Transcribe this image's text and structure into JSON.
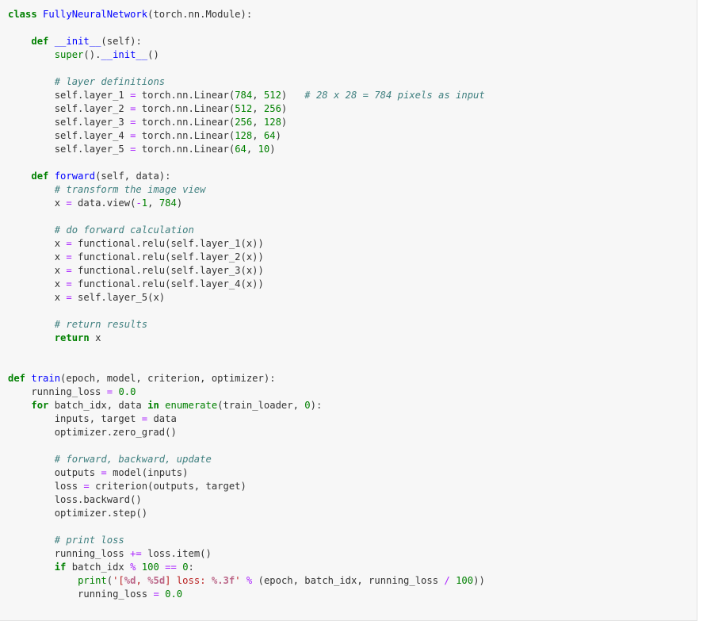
{
  "editor": {
    "language": "python",
    "lines": [
      [
        {
          "t": "class",
          "c": "kw"
        },
        {
          "t": " "
        },
        {
          "t": "FullyNeuralNetwork",
          "c": "fn"
        },
        {
          "t": "(torch.nn.Module):"
        }
      ],
      [],
      [
        {
          "t": "    "
        },
        {
          "t": "def",
          "c": "kw"
        },
        {
          "t": " "
        },
        {
          "t": "__init__",
          "c": "fn"
        },
        {
          "t": "(self):"
        }
      ],
      [
        {
          "t": "        "
        },
        {
          "t": "super",
          "c": "bi"
        },
        {
          "t": "()."
        },
        {
          "t": "__init__",
          "c": "fn"
        },
        {
          "t": "()"
        }
      ],
      [],
      [
        {
          "t": "        "
        },
        {
          "t": "# layer definitions",
          "c": "cm"
        }
      ],
      [
        {
          "t": "        self.layer_1 "
        },
        {
          "t": "=",
          "c": "op"
        },
        {
          "t": " torch.nn.Linear("
        },
        {
          "t": "784",
          "c": "num"
        },
        {
          "t": ", "
        },
        {
          "t": "512",
          "c": "num"
        },
        {
          "t": ")   "
        },
        {
          "t": "# 28 x 28 = 784 pixels as input",
          "c": "cm"
        }
      ],
      [
        {
          "t": "        self.layer_2 "
        },
        {
          "t": "=",
          "c": "op"
        },
        {
          "t": " torch.nn.Linear("
        },
        {
          "t": "512",
          "c": "num"
        },
        {
          "t": ", "
        },
        {
          "t": "256",
          "c": "num"
        },
        {
          "t": ")"
        }
      ],
      [
        {
          "t": "        self.layer_3 "
        },
        {
          "t": "=",
          "c": "op"
        },
        {
          "t": " torch.nn.Linear("
        },
        {
          "t": "256",
          "c": "num"
        },
        {
          "t": ", "
        },
        {
          "t": "128",
          "c": "num"
        },
        {
          "t": ")"
        }
      ],
      [
        {
          "t": "        self.layer_4 "
        },
        {
          "t": "=",
          "c": "op"
        },
        {
          "t": " torch.nn.Linear("
        },
        {
          "t": "128",
          "c": "num"
        },
        {
          "t": ", "
        },
        {
          "t": "64",
          "c": "num"
        },
        {
          "t": ")"
        }
      ],
      [
        {
          "t": "        self.layer_5 "
        },
        {
          "t": "=",
          "c": "op"
        },
        {
          "t": " torch.nn.Linear("
        },
        {
          "t": "64",
          "c": "num"
        },
        {
          "t": ", "
        },
        {
          "t": "10",
          "c": "num"
        },
        {
          "t": ")"
        }
      ],
      [],
      [
        {
          "t": "    "
        },
        {
          "t": "def",
          "c": "kw"
        },
        {
          "t": " "
        },
        {
          "t": "forward",
          "c": "fn"
        },
        {
          "t": "(self, data):"
        }
      ],
      [
        {
          "t": "        "
        },
        {
          "t": "# transform the image view",
          "c": "cm"
        }
      ],
      [
        {
          "t": "        x "
        },
        {
          "t": "=",
          "c": "op"
        },
        {
          "t": " data.view("
        },
        {
          "t": "-",
          "c": "op"
        },
        {
          "t": "1",
          "c": "num"
        },
        {
          "t": ", "
        },
        {
          "t": "784",
          "c": "num"
        },
        {
          "t": ")"
        }
      ],
      [],
      [
        {
          "t": "        "
        },
        {
          "t": "# do forward calculation",
          "c": "cm"
        }
      ],
      [
        {
          "t": "        x "
        },
        {
          "t": "=",
          "c": "op"
        },
        {
          "t": " functional.relu(self.layer_1(x))"
        }
      ],
      [
        {
          "t": "        x "
        },
        {
          "t": "=",
          "c": "op"
        },
        {
          "t": " functional.relu(self.layer_2(x))"
        }
      ],
      [
        {
          "t": "        x "
        },
        {
          "t": "=",
          "c": "op"
        },
        {
          "t": " functional.relu(self.layer_3(x))"
        }
      ],
      [
        {
          "t": "        x "
        },
        {
          "t": "=",
          "c": "op"
        },
        {
          "t": " functional.relu(self.layer_4(x))"
        }
      ],
      [
        {
          "t": "        x "
        },
        {
          "t": "=",
          "c": "op"
        },
        {
          "t": " self.layer_5(x)"
        }
      ],
      [],
      [
        {
          "t": "        "
        },
        {
          "t": "# return results",
          "c": "cm"
        }
      ],
      [
        {
          "t": "        "
        },
        {
          "t": "return",
          "c": "kw"
        },
        {
          "t": " x"
        }
      ],
      [],
      [],
      [
        {
          "t": "def",
          "c": "kw"
        },
        {
          "t": " "
        },
        {
          "t": "train",
          "c": "fn"
        },
        {
          "t": "(epoch, model, criterion, optimizer):"
        }
      ],
      [
        {
          "t": "    running_loss "
        },
        {
          "t": "=",
          "c": "op"
        },
        {
          "t": " "
        },
        {
          "t": "0.0",
          "c": "num"
        }
      ],
      [
        {
          "t": "    "
        },
        {
          "t": "for",
          "c": "kw"
        },
        {
          "t": " batch_idx, data "
        },
        {
          "t": "in",
          "c": "kw"
        },
        {
          "t": " "
        },
        {
          "t": "enumerate",
          "c": "bi"
        },
        {
          "t": "(train_loader, "
        },
        {
          "t": "0",
          "c": "num"
        },
        {
          "t": "):"
        }
      ],
      [
        {
          "t": "        inputs, target "
        },
        {
          "t": "=",
          "c": "op"
        },
        {
          "t": " data"
        }
      ],
      [
        {
          "t": "        optimizer.zero_grad()"
        }
      ],
      [],
      [
        {
          "t": "        "
        },
        {
          "t": "# forward, backward, update",
          "c": "cm"
        }
      ],
      [
        {
          "t": "        outputs "
        },
        {
          "t": "=",
          "c": "op"
        },
        {
          "t": " model(inputs)"
        }
      ],
      [
        {
          "t": "        loss "
        },
        {
          "t": "=",
          "c": "op"
        },
        {
          "t": " criterion(outputs, target)"
        }
      ],
      [
        {
          "t": "        loss.backward()"
        }
      ],
      [
        {
          "t": "        optimizer.step()"
        }
      ],
      [],
      [
        {
          "t": "        "
        },
        {
          "t": "# print loss",
          "c": "cm"
        }
      ],
      [
        {
          "t": "        running_loss "
        },
        {
          "t": "+=",
          "c": "op"
        },
        {
          "t": " loss.item()"
        }
      ],
      [
        {
          "t": "        "
        },
        {
          "t": "if",
          "c": "kw"
        },
        {
          "t": " batch_idx "
        },
        {
          "t": "%",
          "c": "op"
        },
        {
          "t": " "
        },
        {
          "t": "100",
          "c": "num"
        },
        {
          "t": " "
        },
        {
          "t": "==",
          "c": "op"
        },
        {
          "t": " "
        },
        {
          "t": "0",
          "c": "num"
        },
        {
          "t": ":"
        }
      ],
      [
        {
          "t": "            "
        },
        {
          "t": "print",
          "c": "bi"
        },
        {
          "t": "("
        },
        {
          "t": "'[",
          "c": "str"
        },
        {
          "t": "%d",
          "c": "si"
        },
        {
          "t": ", ",
          "c": "str"
        },
        {
          "t": "%5d",
          "c": "si"
        },
        {
          "t": "] loss: ",
          "c": "str"
        },
        {
          "t": "%.3f",
          "c": "si"
        },
        {
          "t": "'",
          "c": "str"
        },
        {
          "t": " "
        },
        {
          "t": "%",
          "c": "op"
        },
        {
          "t": " (epoch, batch_idx, running_loss "
        },
        {
          "t": "/",
          "c": "op"
        },
        {
          "t": " "
        },
        {
          "t": "100",
          "c": "num"
        },
        {
          "t": "))"
        }
      ],
      [
        {
          "t": "            running_loss "
        },
        {
          "t": "=",
          "c": "op"
        },
        {
          "t": " "
        },
        {
          "t": "0.0",
          "c": "num"
        }
      ]
    ]
  }
}
